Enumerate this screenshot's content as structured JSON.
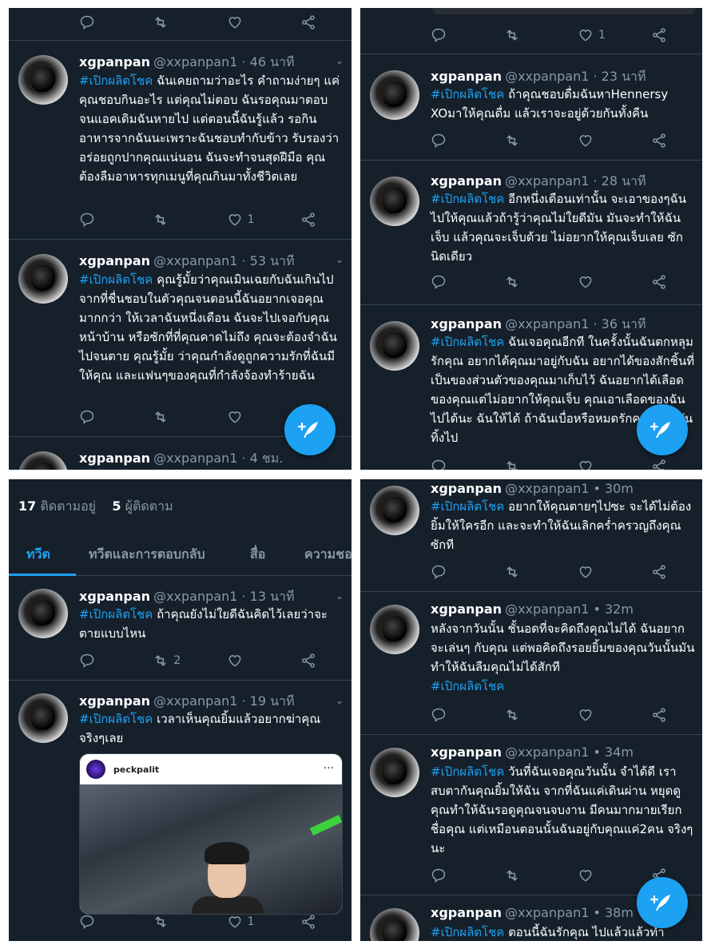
{
  "icons": {
    "reply": "reply-icon",
    "retweet": "retweet-icon",
    "like": "heart-icon",
    "share": "share-icon",
    "compose": "compose-tweet-icon"
  },
  "colors": {
    "background": "#15202b",
    "accent": "#1da1f2",
    "muted": "#8899a6",
    "divider": "#38444d"
  },
  "panel1": {
    "top_actions": {
      "like": "",
      "retweet": ""
    },
    "tweets": [
      {
        "name": "xgpanpan",
        "handle": "@xxpanpan1 · 46 นาที",
        "hashtag": "#เปิกผลิตโชค",
        "text": " ฉันเคยถามว่าอะไร คำถามง่ายๆ แค่ คุณชอบกินอะไร แต่คุณไม่ตอบ ฉันรอคุณมาตอบ จนแอคเดิมฉันหายไป แต่ตอนนี้ฉันรู้แล้ว รอกินอาหารจากฉันนะเพราะฉันชอบทำกับข้าว รับรองว่าอร่อยถูกปากคุณแน่นอน ฉันจะทำจนสุดฝีมือ คุณต้องลืมอาหารทุกเมนูที่คุณกินมาทั้งชีวิตเลย",
        "like_count": "1",
        "retweet_count": ""
      },
      {
        "name": "xgpanpan",
        "handle": "@xxpanpan1 · 53 นาที",
        "hashtag": "#เปิกผลิตโชค",
        "text": " คุณรู้มั้ยว่าคุณเมินเฉยกับฉันเกินไป จากที่ชื่นชอบในตัวคุณจนตอนนี้ฉันอยากเจอคุณมากกว่า ให้เวลาฉันหนึ่งเดือน ฉันจะไปเจอกับคุณหน้าบ้าน หรือซักที่ที่คุณคาดไม่ถึง คุณจะต้องจำฉันไปจนตาย คุณรู้มั้ย ว่าคุณกำลังดูถูกความรักที่ฉันมีให้คุณ และแฟนๆของคุณที่กำลังจ้องทำร้ายฉัน",
        "like_count": "",
        "retweet_count": ""
      },
      {
        "name": "xgpanpan",
        "handle": "@xxpanpan1 · 4 ชม.",
        "hashtag": "",
        "text": "",
        "like_count": "",
        "retweet_count": ""
      }
    ]
  },
  "panel2": {
    "top_actions": {
      "like": "1",
      "retweet": ""
    },
    "tweets": [
      {
        "name": "xgpanpan",
        "handle": "@xxpanpan1 · 23 นาที",
        "hashtag": "#เปิกผลิตโชค",
        "text": " ถ้าคุณชอบดื่มฉันหาHennersy XOมาให้คุณดื่ม แล้วเราจะอยู่ด้วยกันทั้งคืน",
        "like_count": "",
        "retweet_count": ""
      },
      {
        "name": "xgpanpan",
        "handle": "@xxpanpan1 · 28 นาที",
        "hashtag": "#เปิกผลิตโชค",
        "text": " อีกหนึ่งเดือนเท่านั้น จะเอาของๆฉันไปให้คุณแล้วถ้ารู้ว่าคุณไม่ใยดีมัน มันจะทำให้ฉันเจ็บ แล้วคุณจะเจ็บด้วย ไม่อยากให้คุณเจ็บเลย ซักนิดเดียว",
        "like_count": "",
        "retweet_count": ""
      },
      {
        "name": "xgpanpan",
        "handle": "@xxpanpan1 · 36 นาที",
        "hashtag": "#เปิกผลิตโชค",
        "text": " ฉันเจอคุณอีกที ในครั้งนั้นฉันตกหลุมรักคุณ อยากได้คุณมาอยู่กับฉัน อยากได้ของสักชิ้นที่เป็นของส่วนตัวของคุณมาเก็บไว้ ฉันอยากได้เลือดของคุณแต่ไม่อยากให้คุณเจ็บ คุณเอาเลือดของฉันไปได้นะ ฉันให้ได้ ถ้าฉันเบื่อหรือหมดรักคุณก็เอามันทิ้งไป",
        "like_count": "",
        "retweet_count": ""
      }
    ]
  },
  "panel3": {
    "following_count": "17",
    "following_label": "ติดตามอยู่",
    "followers_count": "5",
    "followers_label": "ผู้ติดตาม",
    "tabs": [
      "ทวีต",
      "ทวีตและการตอบกลับ",
      "สื่อ",
      "ความชอบ"
    ],
    "tweets": [
      {
        "name": "xgpanpan",
        "handle": "@xxpanpan1 · 13 นาที",
        "hashtag": "#เปิกผลิตโชค",
        "text": " ถ้าคุณยังไม่ใยดีฉันคิดไว้เลยว่าจะตายแบบไหน",
        "like_count": "",
        "retweet_count": "2"
      },
      {
        "name": "xgpanpan",
        "handle": "@xxpanpan1 · 19 นาที",
        "hashtag": "#เปิกผลิตโชค",
        "text": " เวลาเห็นคุณยิ้มแล้วอยากฆ่าคุณจริงๆเลย",
        "embed_user": "peckpalit",
        "embed_more": "···",
        "like_count": "1",
        "retweet_count": ""
      }
    ]
  },
  "panel4": {
    "tweets": [
      {
        "name": "xgpanpan",
        "handle": "@xxpanpan1 • 30m",
        "hashtag": "#เปิกผลิตโชค",
        "text": " อยากให้คุณตายๆไปซะ จะได้ไม่ต้องยิ้มให้ใครอีก และจะทำให้ฉันเลิกคร่ำครวญถึงคุณซักที",
        "like_count": "",
        "retweet_count": ""
      },
      {
        "name": "xgpanpan",
        "handle": "@xxpanpan1 • 32m",
        "hashtag": "#เปิกผลิตโชค",
        "text": "หลังจากวันนั้น ชั้นอดที่จะคิดถึงคุณไม่ได้ ฉันอยากจะเล่นๆ กับคุณ แต่พอคิดถึงรอยยิ้มของคุณวันนั้นมันทำให้ฉันลืมคุณไม่ได้สักที",
        "like_count": "",
        "retweet_count": ""
      },
      {
        "name": "xgpanpan",
        "handle": "@xxpanpan1 • 34m",
        "hashtag": "#เปิกผลิตโชค",
        "text": " วันที่ฉันเจอคุณวันนั้น จำได้ดี เราสบตากันคุณยิ้มให้ฉัน จากที่ฉันแค่เดินผ่าน หยุดดู คุณทำให้ฉันรอดูคุณจนจบงาน มีคนมากมายเรียกชื่อคุณ แต่เหมือนตอนนั้นฉันอยู่กับคุณแค่2คน จริงๆนะ",
        "like_count": "",
        "retweet_count": ""
      },
      {
        "name": "xgpanpan",
        "handle": "@xxpanpan1 • 38m",
        "hashtag": "#เปิกผลิตโชค",
        "text": " ตอนนี้ฉันรักคุณ ไปแล้วแล้วทำ",
        "like_count": "",
        "retweet_count": ""
      }
    ]
  }
}
